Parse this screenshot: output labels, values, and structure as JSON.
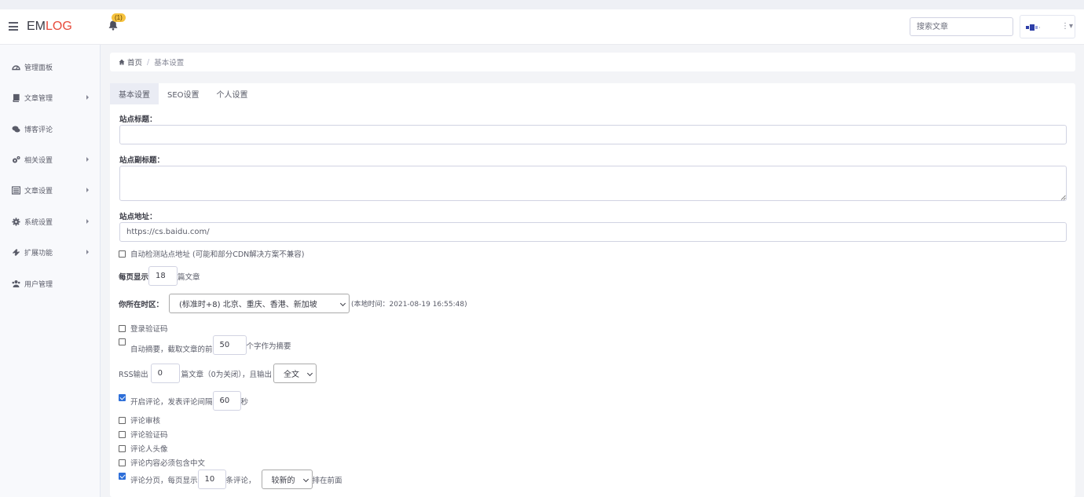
{
  "app": {
    "brand_em": "EM",
    "brand_log": "LOG",
    "notification_count": "(1)"
  },
  "search": {
    "placeholder": "搜索文章"
  },
  "user_menu": {
    "kebab": "⋮▾"
  },
  "sidebar": {
    "items": [
      {
        "label": "管理面板",
        "icon": "dashboard-icon",
        "has_caret": false
      },
      {
        "label": "文章管理",
        "icon": "book-icon",
        "has_caret": true
      },
      {
        "label": "博客评论",
        "icon": "comments-icon",
        "has_caret": false
      },
      {
        "label": "相关设置",
        "icon": "cogs-icon",
        "has_caret": true
      },
      {
        "label": "文章设置",
        "icon": "list-icon",
        "has_caret": true
      },
      {
        "label": "系统设置",
        "icon": "gear-icon",
        "has_caret": true
      },
      {
        "label": "扩展功能",
        "icon": "puzzle-icon",
        "has_caret": true
      },
      {
        "label": "用户管理",
        "icon": "users-icon",
        "has_caret": false
      }
    ]
  },
  "breadcrumb": {
    "home": "首页",
    "separator": "/",
    "current": "基本设置"
  },
  "tabs": [
    {
      "label": "基本设置",
      "active": true
    },
    {
      "label": "SEO设置",
      "active": false
    },
    {
      "label": "个人设置",
      "active": false
    }
  ],
  "form": {
    "site_title_label": "站点标题：",
    "site_title_value": "",
    "site_subtitle_label": "站点副标题：",
    "site_subtitle_value": "",
    "site_url_label": "站点地址：",
    "site_url_value": "https://cs.baidu.com/",
    "auto_detect_url": {
      "label": "自动检测站点地址 (可能和部分CDN解决方案不兼容)",
      "checked": false
    },
    "per_page_prefix": "每页显示",
    "per_page_value": "18",
    "per_page_suffix": "篇文章",
    "timezone_label": "你所在时区：",
    "timezone_value": "(标准时+8) 北京、重庆、香港、新加坡",
    "local_time": "(本地时间：2021-08-19 16:55:48)",
    "login_captcha": {
      "label": "登录验证码",
      "checked": false
    },
    "auto_excerpt": {
      "prefix": "自动摘要，截取文章的前",
      "value": "50",
      "suffix": "个字作为摘要",
      "checked": false
    },
    "rss": {
      "prefix": "RSS输出",
      "value": "0",
      "middle": "篇文章（0为关闭），且输出",
      "mode": "全文"
    },
    "comments_enable": {
      "prefix": "开启评论，发表评论间隔",
      "value": "60",
      "suffix": "秒",
      "checked": true
    },
    "comment_review": {
      "label": "评论审核",
      "checked": false
    },
    "comment_captcha": {
      "label": "评论验证码",
      "checked": false
    },
    "comment_avatar": {
      "label": "评论人头像",
      "checked": false
    },
    "comment_chinese": {
      "label": "评论内容必须包含中文",
      "checked": false
    },
    "comment_paging": {
      "prefix": "评论分页，每页显示",
      "value": "10",
      "middle": "条评论，",
      "order": "较新的",
      "suffix": "排在前面",
      "checked": true
    }
  },
  "colors": {
    "accent": "#e74a3b",
    "checkbox_on": "#2e6fd9",
    "badge": "#f6c23e",
    "sidebar_bg": "#f8f9fc",
    "page_bg": "#f3f4f7"
  }
}
